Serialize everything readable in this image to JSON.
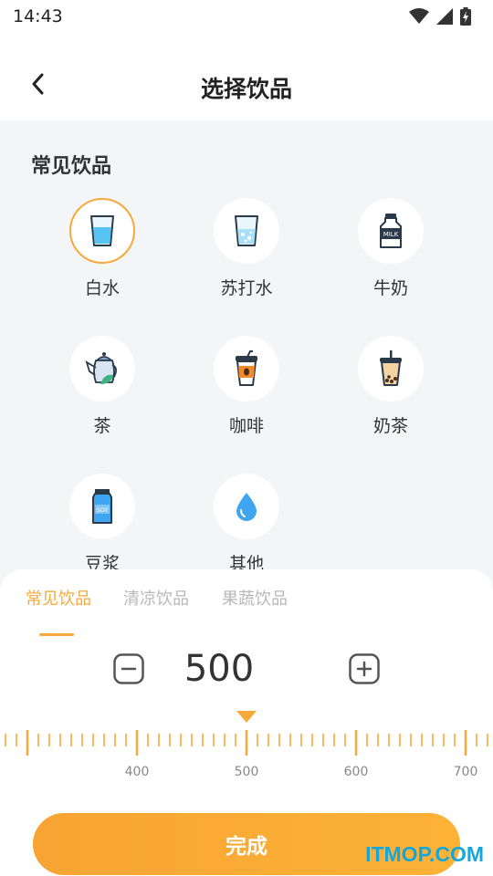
{
  "status": {
    "time": "14:43"
  },
  "header": {
    "title": "选择饮品"
  },
  "section": {
    "title": "常见饮品"
  },
  "drinks": [
    {
      "label": "白水",
      "icon": "water-glass-icon",
      "selected": true
    },
    {
      "label": "苏打水",
      "icon": "soda-water-icon",
      "selected": false
    },
    {
      "label": "牛奶",
      "icon": "milk-bottle-icon",
      "selected": false
    },
    {
      "label": "茶",
      "icon": "teapot-icon",
      "selected": false
    },
    {
      "label": "咖啡",
      "icon": "coffee-cup-icon",
      "selected": false
    },
    {
      "label": "奶茶",
      "icon": "bubble-tea-icon",
      "selected": false
    },
    {
      "label": "豆浆",
      "icon": "soy-milk-carton-icon",
      "selected": false
    },
    {
      "label": "其他",
      "icon": "water-drop-icon",
      "selected": false
    }
  ],
  "icons": {
    "milk_text": "MILK",
    "soy_text": "SOY"
  },
  "tabs": [
    {
      "label": "常见饮品",
      "active": true
    },
    {
      "label": "清凉饮品",
      "active": false
    },
    {
      "label": "果蔬饮品",
      "active": false
    }
  ],
  "amount": {
    "value": "500"
  },
  "ruler": {
    "labels": [
      "400",
      "500",
      "600",
      "700"
    ],
    "selected_value": 500,
    "minor_step": 10,
    "major_step": 100
  },
  "done_button": {
    "label": "完成"
  },
  "watermark": {
    "text": "ITMOP.COM"
  },
  "colors": {
    "accent": "#f7a93a",
    "background": "#f4f5f7",
    "watermark": "#16a7d8"
  }
}
